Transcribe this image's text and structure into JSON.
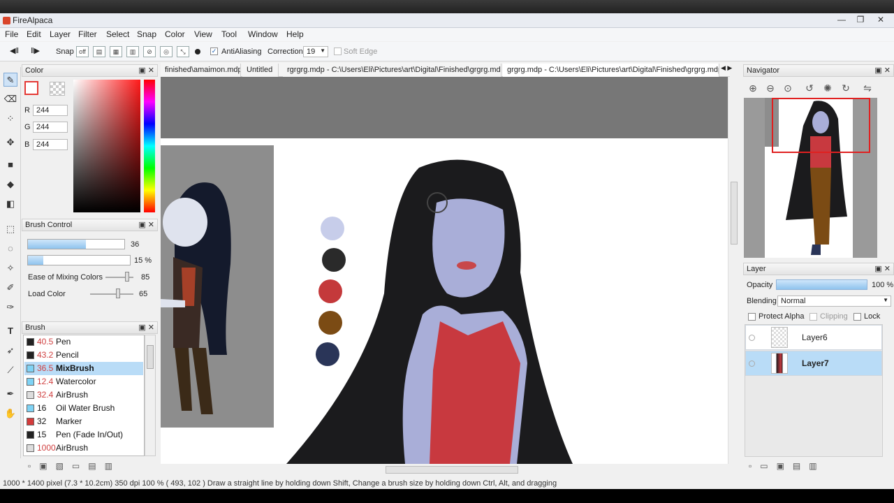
{
  "window": {
    "title": "FireAlpaca",
    "minimize": "—",
    "restore": "❐",
    "close": "✕"
  },
  "menu": [
    "File",
    "Edit",
    "Layer",
    "Filter",
    "Select",
    "Snap",
    "Color",
    "View",
    "Tool",
    "Window",
    "Help"
  ],
  "toolbar": {
    "snap_label": "Snap",
    "snap_off_label": "off",
    "antialiasing_label": "AntiAliasing",
    "antialiasing_checked": "✓",
    "correction_label": "Correction",
    "correction_value": "19",
    "soft_edge_label": "Soft Edge"
  },
  "tabs": [
    "finished\\amaimon.mdp",
    "Untitled",
    "rgrgrg.mdp - C:\\Users\\Eli\\Pictures\\art\\Digital\\Finished\\grgrg.mdp",
    "grgrg.mdp - C:\\Users\\Eli\\Pictures\\art\\Digital\\Finished\\grgrg.mdp"
  ],
  "color_panel": {
    "title": "Color",
    "r_label": "R",
    "r_value": "244",
    "g_label": "G",
    "g_value": "244",
    "b_label": "B",
    "b_value": "244",
    "primary_color": "#e53935"
  },
  "brush_control": {
    "title": "Brush Control",
    "size_value": "36",
    "size_fraction": 0.6,
    "opacity_value": "15 %",
    "opacity_fraction": 0.15,
    "mixing_label": "Ease of Mixing Colors",
    "mixing_value": "85",
    "load_label": "Load Color",
    "load_value": "65"
  },
  "brush_panel": {
    "title": "Brush",
    "items": [
      {
        "size": "40.5",
        "name": "Pen",
        "color": "#222222"
      },
      {
        "size": "43.2",
        "name": "Pencil",
        "color": "#222222"
      },
      {
        "size": "36.5",
        "name": "MixBrush",
        "color": "#7fd3f5"
      },
      {
        "size": "12.4",
        "name": "Watercolor",
        "color": "#7fd3f5"
      },
      {
        "size": "32.4",
        "name": "AirBrush",
        "color": "#dddddd"
      },
      {
        "size": "16",
        "name": "Oil Water Brush",
        "color": "#7fd3f5"
      },
      {
        "size": "32",
        "name": "Marker",
        "color": "#d43b3b"
      },
      {
        "size": "15",
        "name": "Pen (Fade In/Out)",
        "color": "#222222"
      },
      {
        "size": "1000",
        "name": "AirBrush",
        "color": "#dddddd"
      }
    ]
  },
  "navigator": {
    "title": "Navigator"
  },
  "layer_panel": {
    "title": "Layer",
    "opacity_label": "Opacity",
    "opacity_value": "100 %",
    "blending_label": "Blending",
    "blending_value": "Normal",
    "protect_alpha_label": "Protect Alpha",
    "clipping_label": "Clipping",
    "lock_label": "Lock",
    "layers": [
      "Layer6",
      "Layer7"
    ]
  },
  "palette_swatches": [
    "#c7cdea",
    "#2a2a2a",
    "#c4393b",
    "#7b4b14",
    "#2a3558"
  ],
  "status": "1000 * 1400 pixel   (7.3 * 10.2cm)   350 dpi   100 %   ( 493, 102 )   Draw a straight line by holding down Shift, Change a brush size by holding down Ctrl, Alt, and dragging"
}
